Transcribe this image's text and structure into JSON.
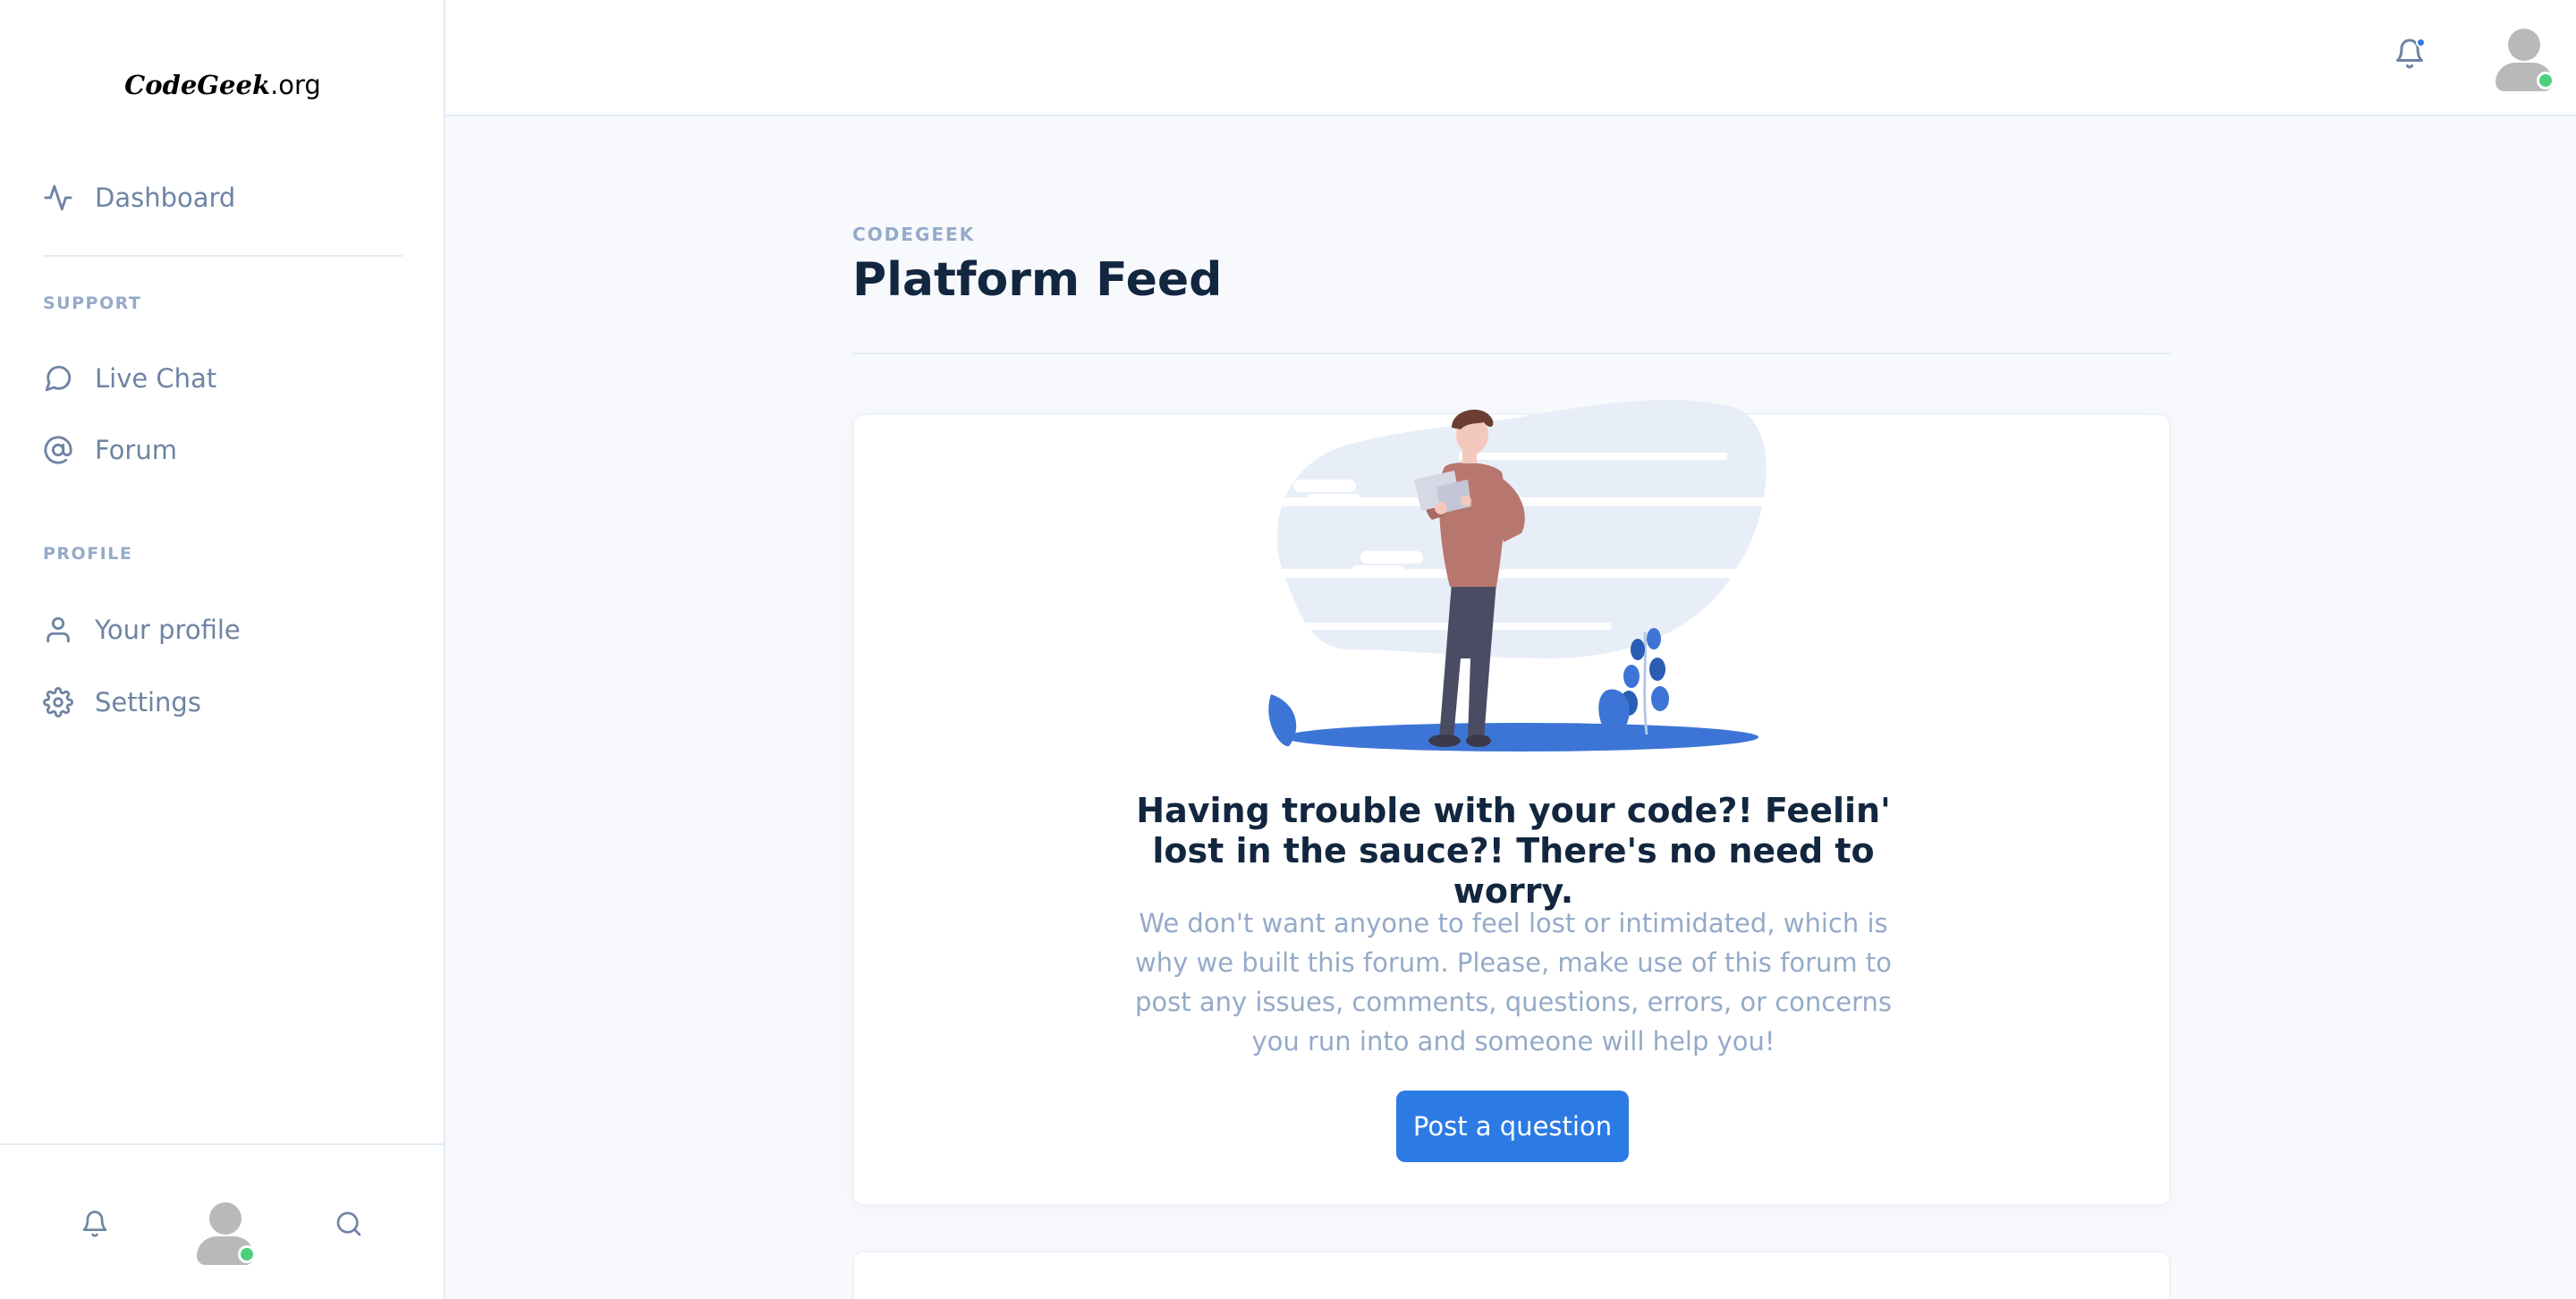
{
  "brand": {
    "name_italic": "CodeGeek",
    "name_suffix": ".org"
  },
  "sidebar": {
    "top_item": {
      "label": "Dashboard",
      "icon": "activity-icon"
    },
    "sections": [
      {
        "heading": "SUPPORT",
        "items": [
          {
            "label": "Live Chat",
            "icon": "message-circle-icon"
          },
          {
            "label": "Forum",
            "icon": "at-sign-icon"
          }
        ]
      },
      {
        "heading": "PROFILE",
        "items": [
          {
            "label": "Your profile",
            "icon": "user-icon"
          },
          {
            "label": "Settings",
            "icon": "settings-icon"
          }
        ]
      }
    ],
    "footer": {
      "icons": [
        "bell-icon",
        "avatar",
        "search-icon"
      ]
    }
  },
  "topbar": {
    "notification_icon": "bell-icon",
    "has_unread": true,
    "user_status": "online"
  },
  "header": {
    "pretitle": "CODEGEEK",
    "title": "Platform Feed"
  },
  "card": {
    "heading": "Having trouble with your code?! Feelin' lost in the sauce?! There's no need to worry.",
    "text": "We don't want anyone to feel lost or intimidated, which is why we built this forum. Please, make use of this forum to post any issues, comments, questions, errors, or concerns you run into and someone will help you!",
    "button_label": "Post a question"
  },
  "colors": {
    "primary": "#2c7be5",
    "online": "#4cd07d",
    "muted_text": "#95aac9",
    "nav_text": "#6e84a3",
    "heading_text": "#12263f"
  }
}
